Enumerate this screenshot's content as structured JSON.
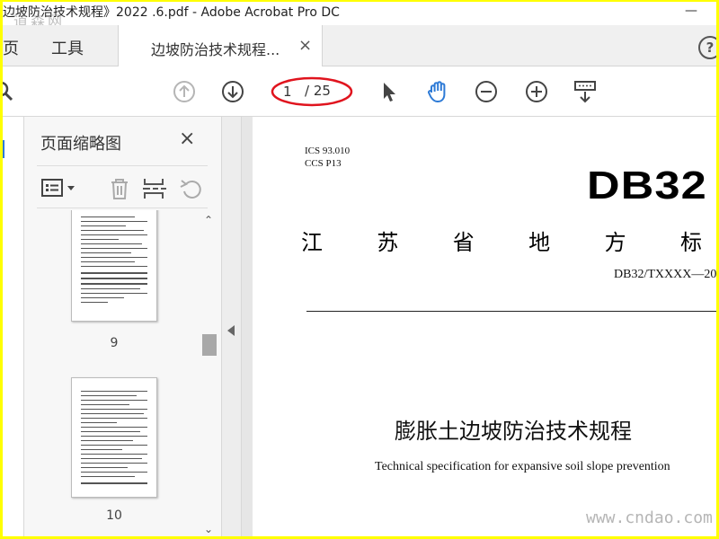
{
  "window": {
    "title": "边坡防治技术规程》2022 .6.pdf - Adobe Acrobat Pro DC",
    "minimize_label": "—",
    "watermark_top": "道森网"
  },
  "tabs": {
    "home_label": "页",
    "tools_label": "工具",
    "doc_label": "边坡防治技术规程...",
    "close_label": "×",
    "help_label": "?"
  },
  "toolbar": {
    "current_page": "1",
    "total_pages": "/ 25",
    "highlight_color": "#e0141e",
    "accent_color": "#2d7ad6",
    "icons": [
      "search-icon",
      "page-up-icon",
      "page-down-icon",
      "select-arrow-icon",
      "hand-tool-icon",
      "zoom-out-icon",
      "zoom-in-icon",
      "scroll-mode-icon"
    ]
  },
  "thumbnail_panel": {
    "title": "页面缩略图",
    "close_label": "×",
    "tools": [
      "options-menu-icon",
      "delete-icon",
      "extract-icon",
      "rotate-icon"
    ],
    "pages": [
      {
        "number": "9"
      },
      {
        "number": "10"
      }
    ]
  },
  "document": {
    "ics": "ICS   93.010",
    "ccs": "CCS  P13",
    "standard_code_large": "DB32",
    "heading_chars": [
      "江",
      "苏",
      "省",
      "地",
      "方",
      "标"
    ],
    "standard_number": "DB32/TXXXX—20",
    "title_cn": "膨胀土边坡防治技术规程",
    "title_en": "Technical specification for expansive soil slope prevention"
  },
  "watermark_bottom": "www.cndao.com"
}
